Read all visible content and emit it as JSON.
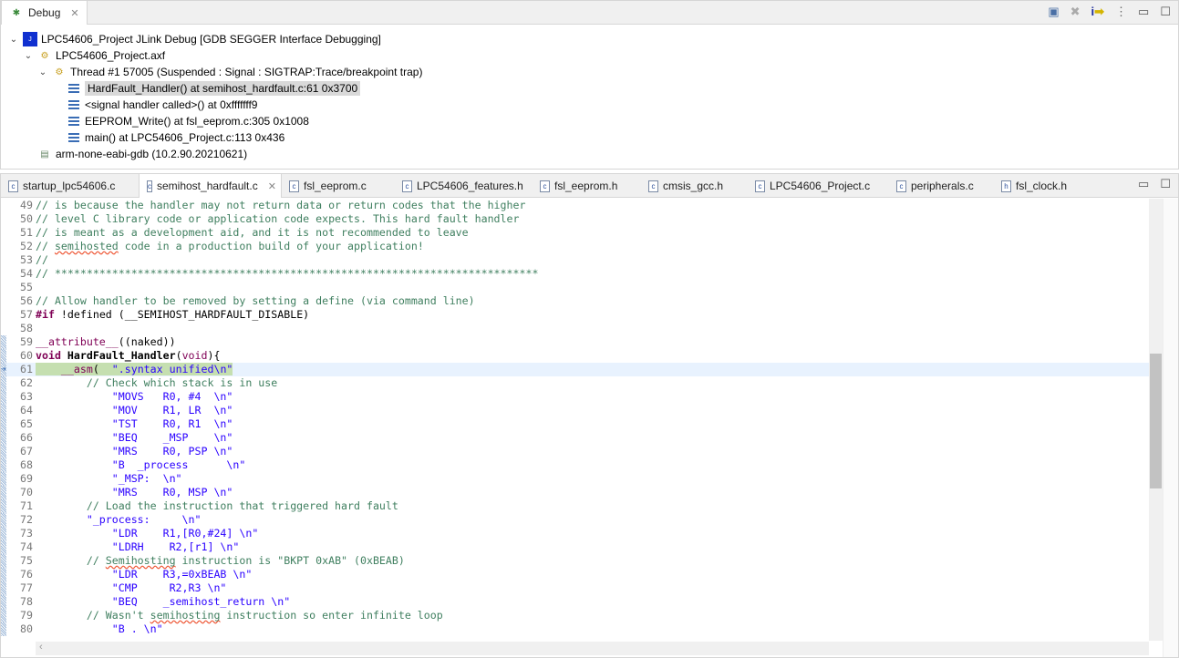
{
  "debug": {
    "tab_label": "Debug",
    "items": [
      {
        "label": "LPC54606_Project JLink Debug [GDB SEGGER Interface Debugging]",
        "icon": "jlink-icon",
        "level": 0
      },
      {
        "label": "LPC54606_Project.axf",
        "icon": "process-icon",
        "level": 1
      },
      {
        "label": "Thread #1 57005 (Suspended : Signal : SIGTRAP:Trace/breakpoint trap)",
        "icon": "thread-icon",
        "level": 2
      },
      {
        "label": "HardFault_Handler() at semihost_hardfault.c:61 0x3700",
        "icon": "stack-frame-icon",
        "level": 3,
        "selected": true
      },
      {
        "label": "<signal handler called>() at 0xfffffff9",
        "icon": "stack-frame-icon",
        "level": 3
      },
      {
        "label": "EEPROM_Write() at fsl_eeprom.c:305 0x1008",
        "icon": "stack-frame-icon",
        "level": 3
      },
      {
        "label": "main() at LPC54606_Project.c:113 0x436",
        "icon": "stack-frame-icon",
        "level": 3
      },
      {
        "label": "arm-none-eabi-gdb (10.2.90.20210621)",
        "icon": "gdb-icon",
        "level": 1
      }
    ]
  },
  "editor": {
    "tabs": [
      {
        "label": "startup_lpc54606.c",
        "type": "c"
      },
      {
        "label": "semihost_hardfault.c",
        "type": "c",
        "active": true
      },
      {
        "label": "fsl_eeprom.c",
        "type": "c"
      },
      {
        "label": "LPC54606_features.h",
        "type": "c"
      },
      {
        "label": "fsl_eeprom.h",
        "type": "c"
      },
      {
        "label": "cmsis_gcc.h",
        "type": "c"
      },
      {
        "label": "LPC54606_Project.c",
        "type": "c"
      },
      {
        "label": "peripherals.c",
        "type": "c"
      },
      {
        "label": "fsl_clock.h",
        "type": "h"
      }
    ],
    "current_line": 61,
    "lines": [
      {
        "n": "49",
        "seg": [
          [
            "c",
            "// is because the handler may not return data or return codes that the higher"
          ]
        ]
      },
      {
        "n": "50",
        "seg": [
          [
            "c",
            "// level C library code or application code expects. This hard fault handler"
          ]
        ]
      },
      {
        "n": "51",
        "seg": [
          [
            "c",
            "// is meant as a development aid, and it is not recommended to leave"
          ]
        ]
      },
      {
        "n": "52",
        "seg": [
          [
            "c",
            "// "
          ],
          [
            "c sq",
            "semihosted"
          ],
          [
            "c",
            " code in a production build of your application!"
          ]
        ]
      },
      {
        "n": "53",
        "seg": [
          [
            "c",
            "//"
          ]
        ]
      },
      {
        "n": "54",
        "seg": [
          [
            "c",
            "// ****************************************************************************"
          ]
        ]
      },
      {
        "n": "55",
        "seg": []
      },
      {
        "n": "56",
        "seg": [
          [
            "c",
            "// Allow handler to be removed by setting a define (via command line)"
          ]
        ]
      },
      {
        "n": "57",
        "seg": [
          [
            "k",
            "#if"
          ],
          [
            "p",
            " !defined (__SEMIHOST_HARDFAULT_DISABLE)"
          ]
        ]
      },
      {
        "n": "58",
        "seg": []
      },
      {
        "n": "59",
        "seg": [
          [
            "m",
            "__attribute__"
          ],
          [
            "p",
            "((naked))"
          ]
        ]
      },
      {
        "n": "60",
        "seg": [
          [
            "k",
            "void"
          ],
          [
            "p",
            " "
          ],
          [
            "p b",
            "HardFault_Handler"
          ],
          [
            "p",
            "("
          ],
          [
            "m",
            "void"
          ],
          [
            "p",
            "){"
          ]
        ]
      },
      {
        "n": "61",
        "seg": [
          [
            "p hl",
            "    "
          ],
          [
            "m hl",
            "__asm"
          ],
          [
            "p hl",
            "(  "
          ],
          [
            "s hl",
            "\".syntax unified\\n\""
          ]
        ]
      },
      {
        "n": "62",
        "seg": [
          [
            "c",
            "        // Check which stack is in use"
          ]
        ]
      },
      {
        "n": "63",
        "seg": [
          [
            "s",
            "            \"MOVS   R0, #4  \\n\""
          ]
        ]
      },
      {
        "n": "64",
        "seg": [
          [
            "s",
            "            \"MOV    R1, LR  \\n\""
          ]
        ]
      },
      {
        "n": "65",
        "seg": [
          [
            "s",
            "            \"TST    R0, R1  \\n\""
          ]
        ]
      },
      {
        "n": "66",
        "seg": [
          [
            "s",
            "            \"BEQ    _MSP    \\n\""
          ]
        ]
      },
      {
        "n": "67",
        "seg": [
          [
            "s",
            "            \"MRS    R0, PSP \\n\""
          ]
        ]
      },
      {
        "n": "68",
        "seg": [
          [
            "s",
            "            \"B  _process      \\n\""
          ]
        ]
      },
      {
        "n": "69",
        "seg": [
          [
            "s",
            "            \"_MSP:  \\n\""
          ]
        ]
      },
      {
        "n": "70",
        "seg": [
          [
            "s",
            "            \"MRS    R0, MSP \\n\""
          ]
        ]
      },
      {
        "n": "71",
        "seg": [
          [
            "c",
            "        // Load the instruction that triggered hard fault"
          ]
        ]
      },
      {
        "n": "72",
        "seg": [
          [
            "s",
            "        \"_process:     \\n\""
          ]
        ]
      },
      {
        "n": "73",
        "seg": [
          [
            "s",
            "            \"LDR    R1,[R0,#24] \\n\""
          ]
        ]
      },
      {
        "n": "74",
        "seg": [
          [
            "s",
            "            \"LDRH    R2,[r1] \\n\""
          ]
        ]
      },
      {
        "n": "75",
        "seg": [
          [
            "c",
            "        // "
          ],
          [
            "c sq",
            "Semihosting"
          ],
          [
            "c",
            " instruction is \"BKPT 0xAB\" (0xBEAB)"
          ]
        ]
      },
      {
        "n": "76",
        "seg": [
          [
            "s",
            "            \"LDR    R3,=0xBEAB \\n\""
          ]
        ]
      },
      {
        "n": "77",
        "seg": [
          [
            "s",
            "            \"CMP     R2,R3 \\n\""
          ]
        ]
      },
      {
        "n": "78",
        "seg": [
          [
            "s",
            "            \"BEQ    _semihost_return \\n\""
          ]
        ]
      },
      {
        "n": "79",
        "seg": [
          [
            "c",
            "        // Wasn't "
          ],
          [
            "c sq",
            "semihosting"
          ],
          [
            "c",
            " instruction so enter infinite loop"
          ]
        ]
      },
      {
        "n": "80",
        "seg": [
          [
            "s",
            "            \"B . \\n\""
          ]
        ]
      }
    ],
    "scroll_position_fraction": 0.5
  },
  "colors": {
    "comment": "#3f7f5f",
    "keyword": "#7f0055",
    "string": "#2a00ff",
    "current_line": "#e8f2fe",
    "highlight": "#c5dfb0"
  }
}
